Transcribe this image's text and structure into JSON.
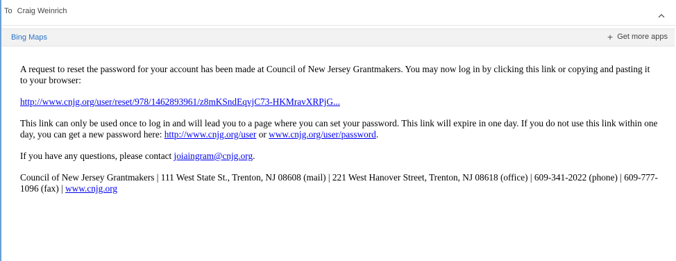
{
  "header": {
    "to_label": "To",
    "recipient": "Craig Weinrich"
  },
  "apps_bar": {
    "app_name": "Bing Maps",
    "get_more_label": "Get more apps"
  },
  "message": {
    "p1": "A request to reset the password for your account has been made at Council of New Jersey Grantmakers. You may now log in by clicking this link or copying and pasting it to your browser:",
    "reset_link": "http://www.cnjg.org/user/reset/978/1462893961/z8mKSndEqvjC73-HKMravXRPjG...",
    "p3_text": "This link can only be used once to log in and will lead you to a page where you can set your password. This link will expire in one day. If you do not use this link within one day, you can get a new password here:",
    "user_link": "http://www.cnjg.org/user",
    "or_text": "or",
    "password_link": "www.cnjg.org/user/password",
    "p3_end": ".",
    "questions_text": "If you have any questions, please contact",
    "contact_email": "joiaingram@cnjg.org",
    "questions_end": ".",
    "footer_text": "Council of New Jersey Grantmakers | 111 West State St., Trenton, NJ 08608 (mail) | 221 West Hanover Street, Trenton, NJ 08618 (office) | 609-341-2022 (phone) | 609-777-1096 (fax) |",
    "footer_link": "www.cnjg.org"
  }
}
